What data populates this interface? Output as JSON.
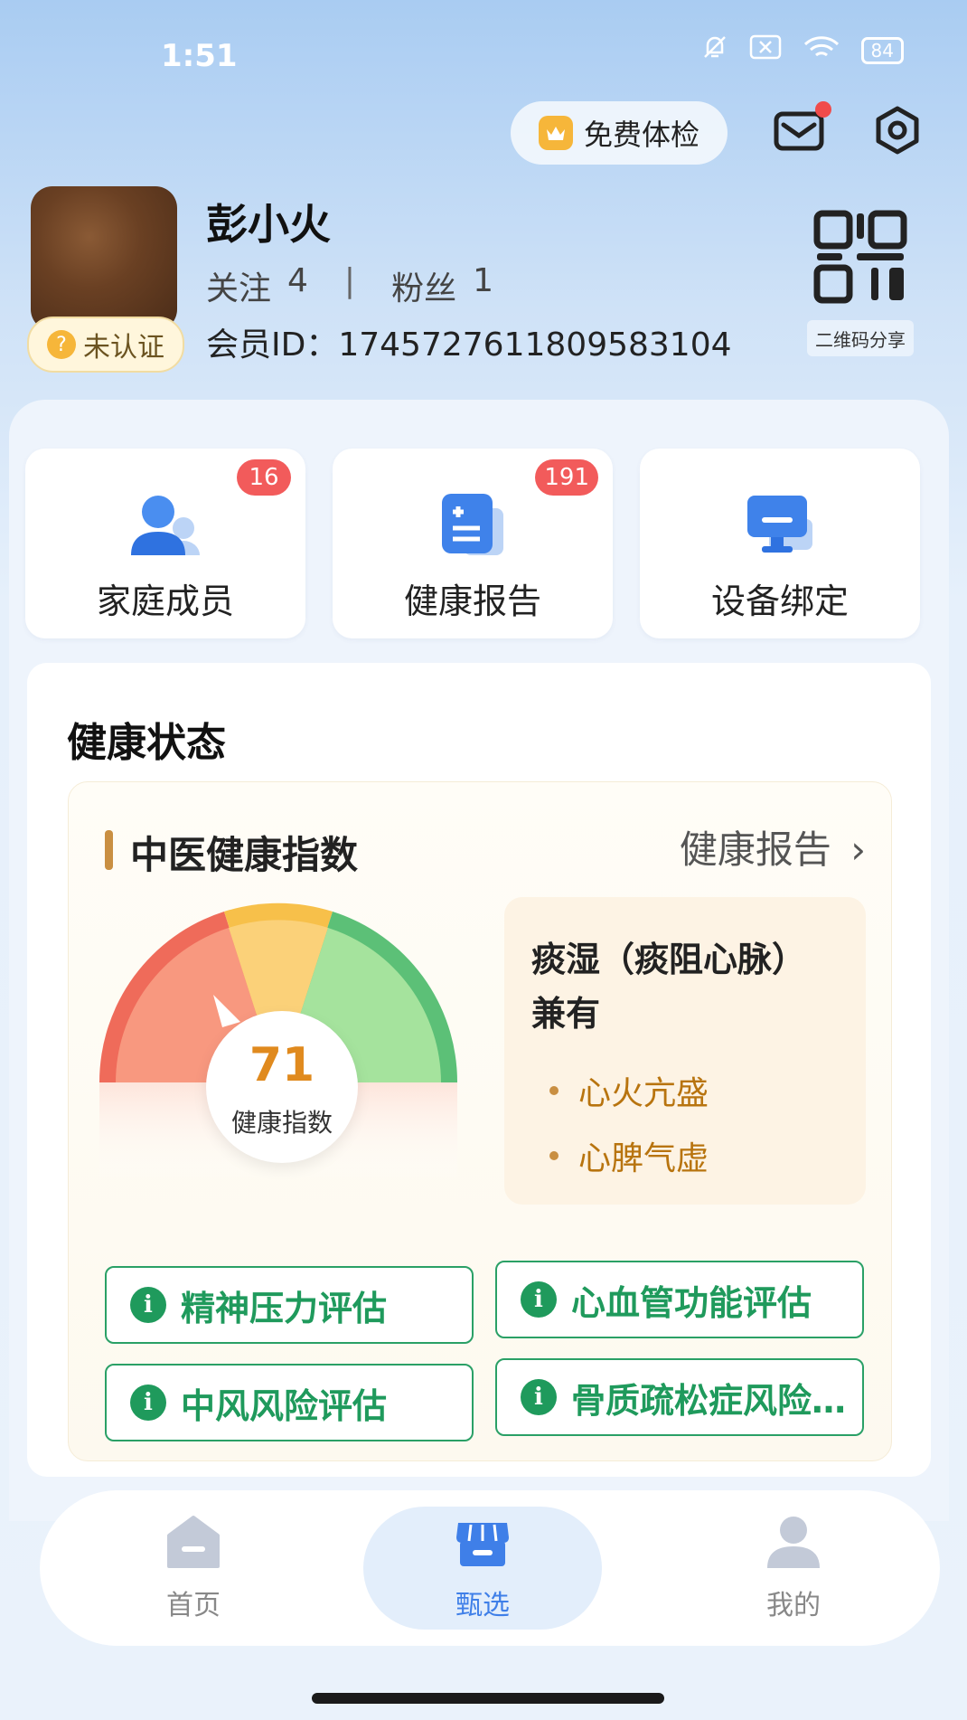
{
  "status": {
    "time": "1:51",
    "battery": "84"
  },
  "header": {
    "free_exam": "免费体检"
  },
  "profile": {
    "name": "彭小火",
    "follow_label": "关注",
    "follow_count": "4",
    "divider": "|",
    "fans_label": "粉丝",
    "fans_count": "1",
    "member_id": "会员ID：1745727611809583104",
    "cert_badge": "未认证",
    "qr_label": "二维码分享"
  },
  "shortcuts": [
    {
      "label": "家庭成员",
      "badge": "16",
      "icon": "family-icon"
    },
    {
      "label": "健康报告",
      "badge": "191",
      "icon": "report-icon"
    },
    {
      "label": "设备绑定",
      "badge": "",
      "icon": "device-icon"
    }
  ],
  "health": {
    "title": "健康状态",
    "tcm_title": "中医健康指数",
    "report_link": "健康报告",
    "score": "71",
    "score_label": "健康指数",
    "constitution_line1": "痰湿（痰阻心脉）",
    "constitution_line2": "兼有",
    "tags": [
      "心火亢盛",
      "心脾气虚"
    ],
    "assessments": [
      "精神压力评估",
      "心血管功能评估",
      "中风风险评估",
      "骨质疏松症风险…"
    ]
  },
  "nav": {
    "items": [
      {
        "label": "首页",
        "active": false
      },
      {
        "label": "甄选",
        "active": true
      },
      {
        "label": "我的",
        "active": false
      }
    ]
  },
  "colors": {
    "gauge_red": "#ef6b5a",
    "gauge_yellow": "#f7c04a",
    "gauge_green": "#5cc077",
    "assess_green": "#1f9a5c",
    "accent_blue": "#3f7fe8"
  }
}
